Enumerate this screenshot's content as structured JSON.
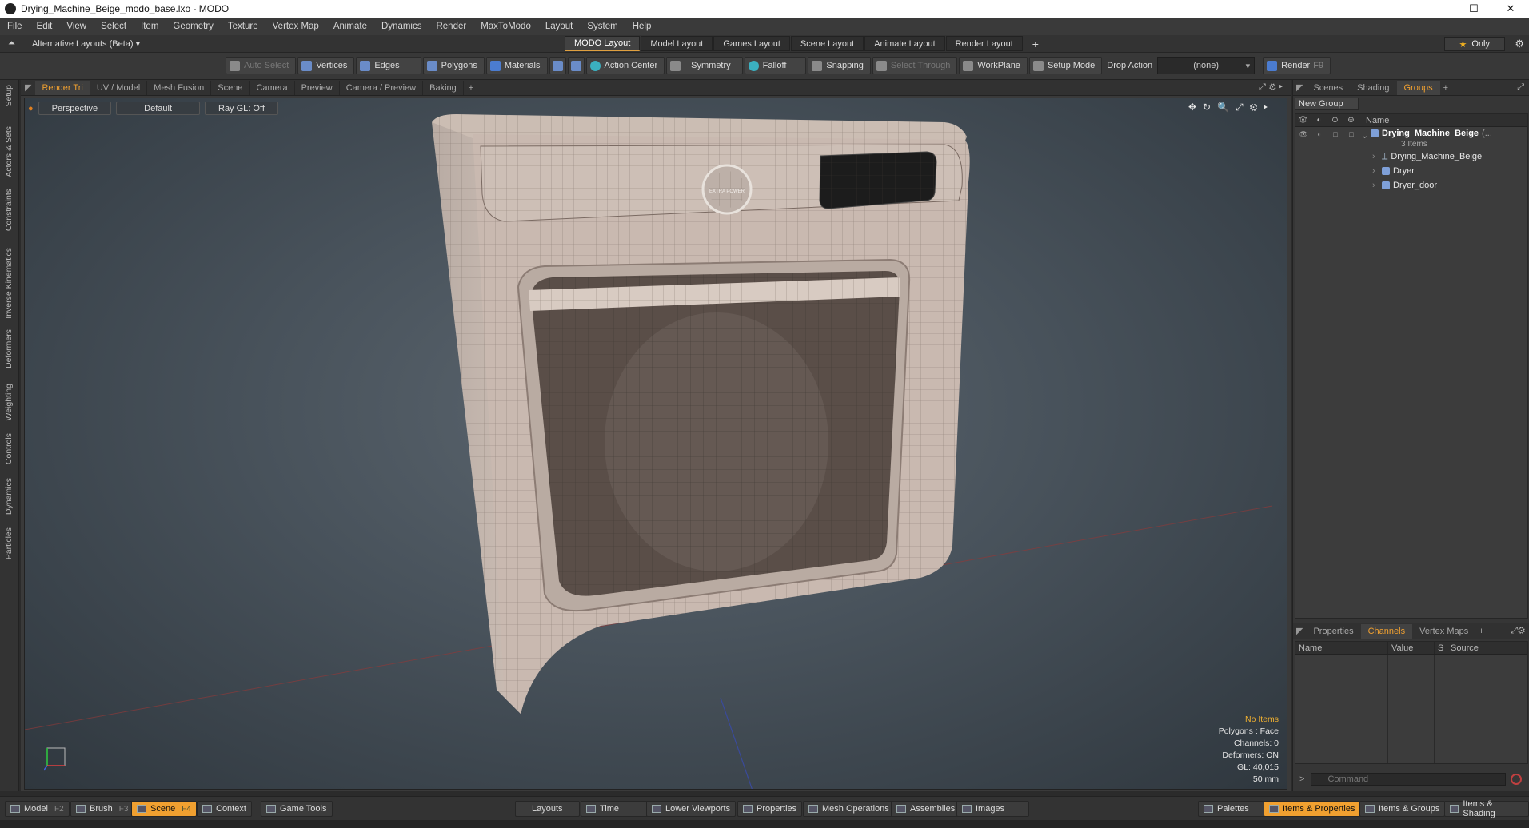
{
  "window": {
    "title": "Drying_Machine_Beige_modo_base.lxo - MODO",
    "min": "—",
    "max": "☐",
    "close": "✕"
  },
  "menu": [
    "File",
    "Edit",
    "View",
    "Select",
    "Item",
    "Geometry",
    "Texture",
    "Vertex Map",
    "Animate",
    "Dynamics",
    "Render",
    "MaxToModo",
    "Layout",
    "System",
    "Help"
  ],
  "layouts": {
    "alt_label": "Alternative Layouts (Beta) ▾",
    "tabs": [
      "MODO Layout",
      "Model Layout",
      "Games Layout",
      "Scene Layout",
      "Animate Layout",
      "Render Layout"
    ],
    "add": "+",
    "only": "Only"
  },
  "toolbar": {
    "auto_select": "Auto Select",
    "vertices": "Vertices",
    "edges": "Edges",
    "polygons": "Polygons",
    "materials": "Materials",
    "action_center": "Action Center",
    "symmetry": "Symmetry",
    "falloff": "Falloff",
    "snapping": "Snapping",
    "select_through": "Select Through",
    "workplane": "WorkPlane",
    "setup_mode": "Setup Mode",
    "drop_action_label": "Drop Action",
    "drop_action_value": "(none)",
    "render": "Render",
    "render_key": "F9"
  },
  "left_tabs": [
    "Setup",
    "Actors & Sets",
    "Constraints",
    "Inverse Kinematics",
    "Deformers",
    "Weighting",
    "Controls",
    "Dynamics",
    "Particles"
  ],
  "viewport_tabs": [
    "Render Tri",
    "UV / Model",
    "Mesh Fusion",
    "Scene",
    "Camera",
    "Preview",
    "Camera / Preview",
    "Baking"
  ],
  "viewport": {
    "view": "Perspective",
    "shading": "Default",
    "raygl": "Ray GL: Off",
    "badge_text": "EXTRA POWER",
    "stats": {
      "no_items": "No Items",
      "polygons": "Polygons : Face",
      "channels": "Channels: 0",
      "deformers": "Deformers: ON",
      "gl": "GL: 40,015",
      "focal": "50 mm"
    }
  },
  "right_tabs": [
    "Scenes",
    "Shading",
    "Groups"
  ],
  "groups": {
    "new_group": "New Group",
    "header_name": "Name",
    "root": "Drying_Machine_Beige",
    "root_suffix": "(...",
    "root_count": "3 Items",
    "children": [
      "Drying_Machine_Beige",
      "Dryer",
      "Dryer_door"
    ]
  },
  "prop_tabs": [
    "Properties",
    "Channels",
    "Vertex Maps"
  ],
  "channels": {
    "name": "Name",
    "value": "Value",
    "s": "S",
    "source": "Source"
  },
  "command": {
    "prompt": ">",
    "placeholder": "Command"
  },
  "bottom": {
    "model": "Model",
    "model_key": "F2",
    "brush": "Brush",
    "brush_key": "F3",
    "scene": "Scene",
    "scene_key": "F4",
    "context": "Context",
    "game_tools": "Game Tools",
    "layouts": "Layouts",
    "time": "Time",
    "lower_viewports": "Lower Viewports",
    "properties": "Properties",
    "mesh_operations": "Mesh Operations",
    "assemblies": "Assemblies",
    "images": "Images",
    "palettes": "Palettes",
    "items_properties": "Items & Properties",
    "items_groups": "Items & Groups",
    "items_shading": "Items & Shading"
  }
}
